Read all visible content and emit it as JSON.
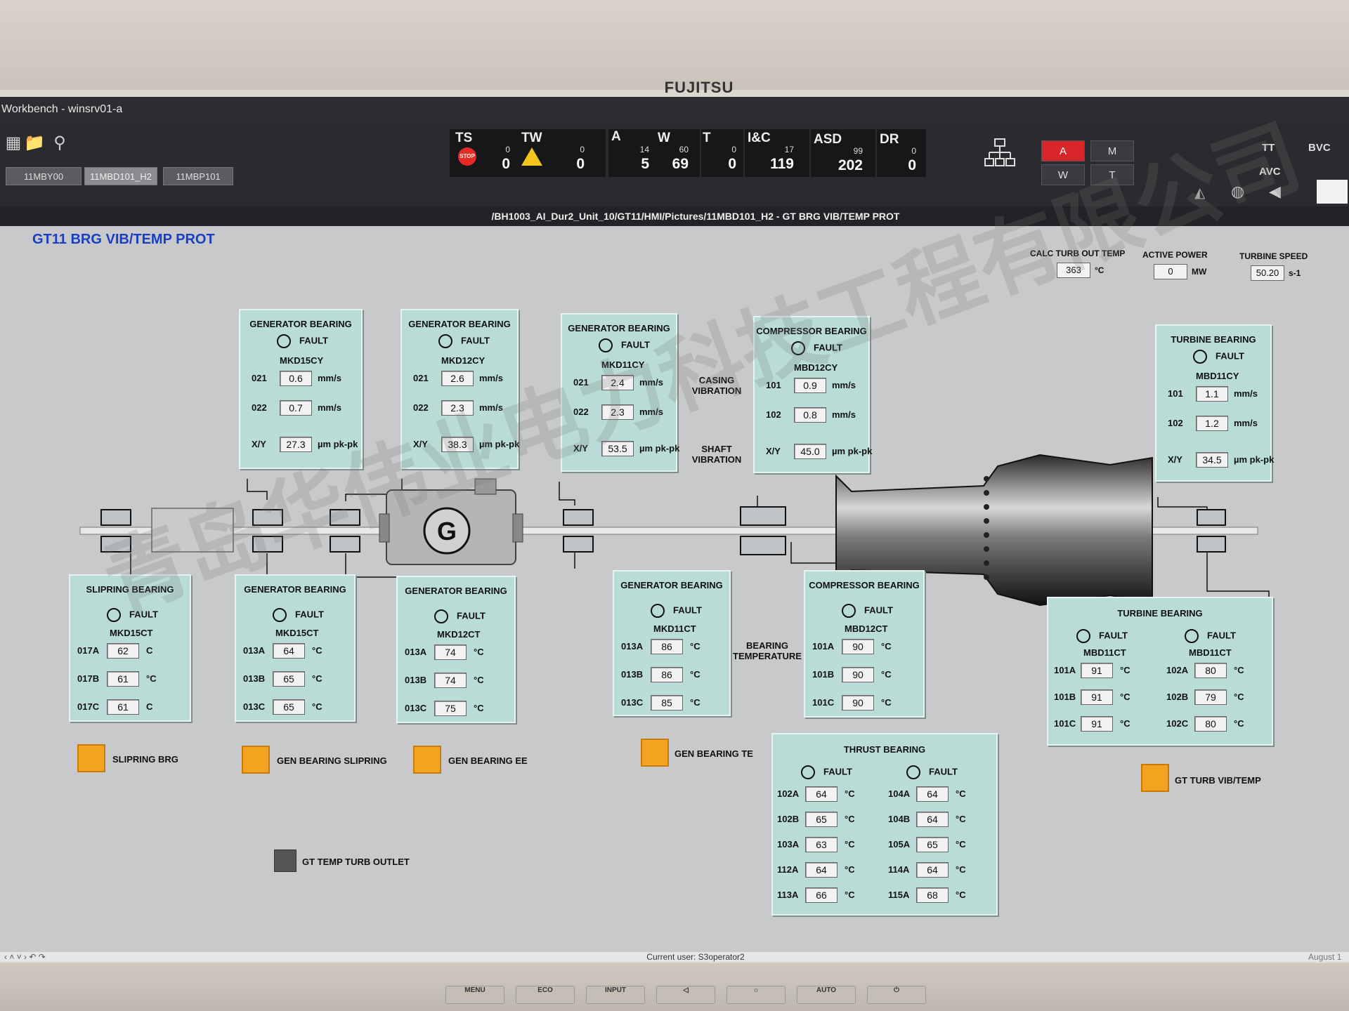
{
  "monitor": {
    "brand": "FUJITSU"
  },
  "window": {
    "title": "Workbench - winsrv01-a"
  },
  "tabs": [
    {
      "label": "11MBY00"
    },
    {
      "label": "11MBD101_H2"
    },
    {
      "label": "11MBP101"
    }
  ],
  "alarms": {
    "ts": {
      "label": "TS",
      "small": "0",
      "count": "0",
      "stop_icon": "STOP"
    },
    "tw": {
      "label": "TW",
      "small": "0",
      "count": "0"
    },
    "a": {
      "label": "A",
      "small": "14",
      "count": "5"
    },
    "w": {
      "label": "W",
      "small": "60",
      "count": "69"
    },
    "t": {
      "label": "T",
      "small": "0",
      "count": "0"
    },
    "ic": {
      "label": "I&C",
      "small": "17",
      "count": "119"
    },
    "asd": {
      "label": "ASD",
      "small": "99",
      "count": "202"
    },
    "dr": {
      "label": "DR",
      "small": "0",
      "count": "0"
    }
  },
  "modes": {
    "a": "A",
    "m": "M",
    "w": "W",
    "t": "T"
  },
  "right_buttons": {
    "tt": "TT",
    "bvc": "BVC",
    "avc": "AVC"
  },
  "path": "/BH1003_AI_Dur2_Unit_10/GT11/HMI/Pictures/11MBD101_H2 - GT BRG VIB/TEMP PROT",
  "page_title": "GT11 BRG VIB/TEMP PROT",
  "stats": {
    "calc_turb_out_temp": {
      "label": "CALC TURB OUT TEMP",
      "value": "363",
      "unit": "°C"
    },
    "active_power": {
      "label": "ACTIVE POWER",
      "value": "0",
      "unit": "MW"
    },
    "turbine_speed": {
      "label": "TURBINE SPEED",
      "value": "50.20",
      "unit": "s-1"
    }
  },
  "labels": {
    "casing_vibration": "CASING\nVIBRATION",
    "shaft_vibration": "SHAFT\nVIBRATION",
    "bearing_temperature": "BEARING\nTEMPERATURE",
    "generator_mark": "G"
  },
  "fault": "FAULT",
  "vib_panels": [
    {
      "title": "GENERATOR BEARING",
      "tag": "MKD15CY",
      "rows": [
        {
          "l": "021",
          "v": "0.6",
          "u": "mm/s"
        },
        {
          "l": "022",
          "v": "0.7",
          "u": "mm/s"
        },
        {
          "l": "X/Y",
          "v": "27.3",
          "u": "µm pk-pk"
        }
      ]
    },
    {
      "title": "GENERATOR BEARING",
      "tag": "MKD12CY",
      "rows": [
        {
          "l": "021",
          "v": "2.6",
          "u": "mm/s"
        },
        {
          "l": "022",
          "v": "2.3",
          "u": "mm/s"
        },
        {
          "l": "X/Y",
          "v": "38.3",
          "u": "µm pk-pk"
        }
      ]
    },
    {
      "title": "GENERATOR BEARING",
      "tag": "MKD11CY",
      "rows": [
        {
          "l": "021",
          "v": "2.4",
          "u": "mm/s"
        },
        {
          "l": "022",
          "v": "2.3",
          "u": "mm/s"
        },
        {
          "l": "X/Y",
          "v": "53.5",
          "u": "µm pk-pk"
        }
      ]
    },
    {
      "title": "COMPRESSOR BEARING",
      "tag": "MBD12CY",
      "rows": [
        {
          "l": "101",
          "v": "0.9",
          "u": "mm/s"
        },
        {
          "l": "102",
          "v": "0.8",
          "u": "mm/s"
        },
        {
          "l": "X/Y",
          "v": "45.0",
          "u": "µm pk-pk"
        }
      ]
    },
    {
      "title": "TURBINE BEARING",
      "tag": "MBD11CY",
      "rows": [
        {
          "l": "101",
          "v": "1.1",
          "u": "mm/s"
        },
        {
          "l": "102",
          "v": "1.2",
          "u": "mm/s"
        },
        {
          "l": "X/Y",
          "v": "34.5",
          "u": "µm pk-pk"
        }
      ]
    }
  ],
  "temp_panels": [
    {
      "title": "SLIPRING BEARING",
      "tag": "MKD15CT",
      "rows": [
        {
          "l": "017A",
          "v": "62",
          "u": "C"
        },
        {
          "l": "017B",
          "v": "61",
          "u": "°C"
        },
        {
          "l": "017C",
          "v": "61",
          "u": "C"
        }
      ]
    },
    {
      "title": "GENERATOR BEARING",
      "tag": "MKD15CT",
      "rows": [
        {
          "l": "013A",
          "v": "64",
          "u": "°C"
        },
        {
          "l": "013B",
          "v": "65",
          "u": "°C"
        },
        {
          "l": "013C",
          "v": "65",
          "u": "°C"
        }
      ]
    },
    {
      "title": "GENERATOR BEARING",
      "tag": "MKD12CT",
      "rows": [
        {
          "l": "013A",
          "v": "74",
          "u": "°C"
        },
        {
          "l": "013B",
          "v": "74",
          "u": "°C"
        },
        {
          "l": "013C",
          "v": "75",
          "u": "°C"
        }
      ]
    },
    {
      "title": "GENERATOR BEARING",
      "tag": "MKD11CT",
      "rows": [
        {
          "l": "013A",
          "v": "86",
          "u": "°C"
        },
        {
          "l": "013B",
          "v": "86",
          "u": "°C"
        },
        {
          "l": "013C",
          "v": "85",
          "u": "°C"
        }
      ]
    },
    {
      "title": "COMPRESSOR BEARING",
      "tag": "MBD12CT",
      "rows": [
        {
          "l": "101A",
          "v": "90",
          "u": "°C"
        },
        {
          "l": "101B",
          "v": "90",
          "u": "°C"
        },
        {
          "l": "101C",
          "v": "90",
          "u": "°C"
        }
      ]
    }
  ],
  "turbine_temp": {
    "title": "TURBINE BEARING",
    "left": {
      "tag": "MBD11CT",
      "rows": [
        {
          "l": "101A",
          "v": "91",
          "u": "°C"
        },
        {
          "l": "101B",
          "v": "91",
          "u": "°C"
        },
        {
          "l": "101C",
          "v": "91",
          "u": "°C"
        }
      ]
    },
    "right": {
      "tag": "MBD11CT",
      "rows": [
        {
          "l": "102A",
          "v": "80",
          "u": "°C"
        },
        {
          "l": "102B",
          "v": "79",
          "u": "°C"
        },
        {
          "l": "102C",
          "v": "80",
          "u": "°C"
        }
      ]
    }
  },
  "thrust": {
    "title": "THRUST  BEARING",
    "left": [
      {
        "l": "102A",
        "v": "64",
        "u": "°C"
      },
      {
        "l": "102B",
        "v": "65",
        "u": "°C"
      },
      {
        "l": "103A",
        "v": "63",
        "u": "°C"
      },
      {
        "l": "112A",
        "v": "64",
        "u": "°C"
      },
      {
        "l": "113A",
        "v": "66",
        "u": "°C"
      }
    ],
    "right": [
      {
        "l": "104A",
        "v": "64",
        "u": "°C"
      },
      {
        "l": "104B",
        "v": "64",
        "u": "°C"
      },
      {
        "l": "105A",
        "v": "65",
        "u": "°C"
      },
      {
        "l": "114A",
        "v": "64",
        "u": "°C"
      },
      {
        "l": "115A",
        "v": "68",
        "u": "°C"
      }
    ]
  },
  "nav_buttons": {
    "slipring": "SLIPRING BRG",
    "gen_slipring": "GEN BEARING SLIPRING",
    "gen_ee": "GEN BEARING EE",
    "gen_te": "GEN BEARING TE",
    "gt_turb": "GT TURB VIB/TEMP",
    "gt_temp_outlet": "GT TEMP TURB OUTLET"
  },
  "status": {
    "user": "Current user:  S3operator2",
    "date": "August 1"
  },
  "watermark": "青岛华伟业电力科技工程有限公司",
  "bezel_buttons": [
    "MENU",
    "ECO",
    "INPUT",
    "◁",
    "☼",
    "AUTO",
    "⏻"
  ],
  "colors": {
    "panel": "#b9ddd6",
    "title_blue": "#1a3fc4",
    "alarm_red": "#d8262a",
    "nav_orange": "#f2a31f"
  }
}
